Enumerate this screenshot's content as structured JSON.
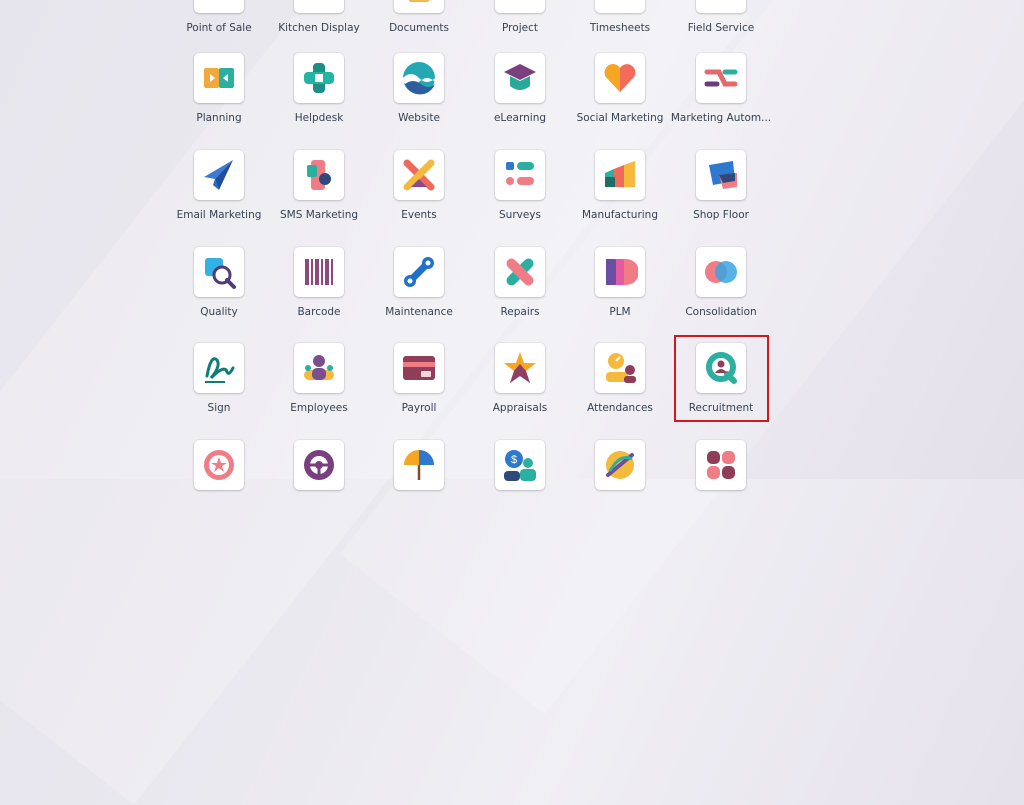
{
  "apps": [
    {
      "label": "Point of Sale",
      "icon": "point-of-sale-icon"
    },
    {
      "label": "Kitchen Display",
      "icon": "kitchen-display-icon"
    },
    {
      "label": "Documents",
      "icon": "documents-icon"
    },
    {
      "label": "Project",
      "icon": "project-icon"
    },
    {
      "label": "Timesheets",
      "icon": "timesheets-icon"
    },
    {
      "label": "Field Service",
      "icon": "field-service-icon"
    },
    {
      "label": "Planning",
      "icon": "planning-icon"
    },
    {
      "label": "Helpdesk",
      "icon": "helpdesk-icon"
    },
    {
      "label": "Website",
      "icon": "website-icon"
    },
    {
      "label": "eLearning",
      "icon": "elearning-icon"
    },
    {
      "label": "Social Marketing",
      "icon": "social-marketing-icon"
    },
    {
      "label": "Marketing Autom...",
      "icon": "marketing-automation-icon"
    },
    {
      "label": "Email Marketing",
      "icon": "email-marketing-icon"
    },
    {
      "label": "SMS Marketing",
      "icon": "sms-marketing-icon"
    },
    {
      "label": "Events",
      "icon": "events-icon"
    },
    {
      "label": "Surveys",
      "icon": "surveys-icon"
    },
    {
      "label": "Manufacturing",
      "icon": "manufacturing-icon"
    },
    {
      "label": "Shop Floor",
      "icon": "shop-floor-icon"
    },
    {
      "label": "Quality",
      "icon": "quality-icon"
    },
    {
      "label": "Barcode",
      "icon": "barcode-icon"
    },
    {
      "label": "Maintenance",
      "icon": "maintenance-icon"
    },
    {
      "label": "Repairs",
      "icon": "repairs-icon"
    },
    {
      "label": "PLM",
      "icon": "plm-icon"
    },
    {
      "label": "Consolidation",
      "icon": "consolidation-icon"
    },
    {
      "label": "Sign",
      "icon": "sign-icon"
    },
    {
      "label": "Employees",
      "icon": "employees-icon"
    },
    {
      "label": "Payroll",
      "icon": "payroll-icon"
    },
    {
      "label": "Appraisals",
      "icon": "appraisals-icon"
    },
    {
      "label": "Attendances",
      "icon": "attendances-icon"
    },
    {
      "label": "Recruitment",
      "icon": "recruitment-icon"
    },
    {
      "label": "",
      "icon": "referrals-icon"
    },
    {
      "label": "",
      "icon": "fleet-icon"
    },
    {
      "label": "",
      "icon": "time-off-icon"
    },
    {
      "label": "",
      "icon": "expenses-icon"
    },
    {
      "label": "",
      "icon": "lunch-icon"
    },
    {
      "label": "",
      "icon": "knowledge-icon"
    }
  ],
  "highlighted_app": "Recruitment",
  "highlight_color": "#d11a1f"
}
